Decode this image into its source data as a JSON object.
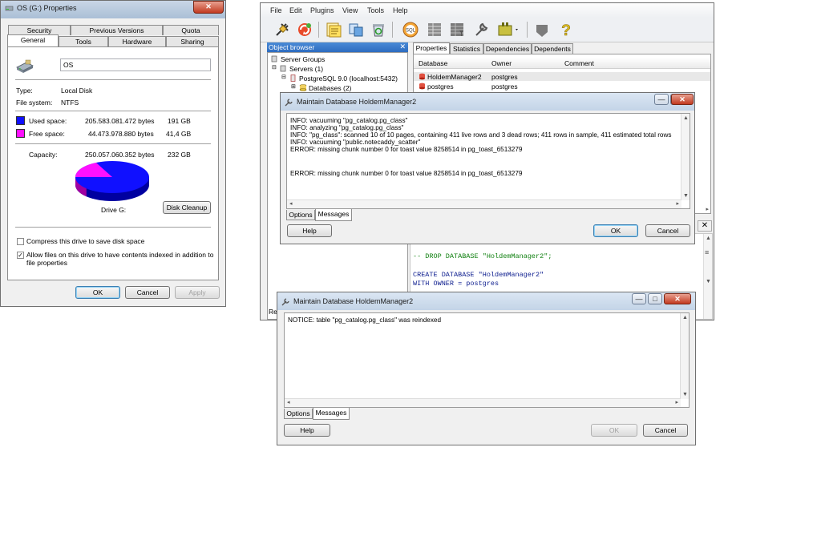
{
  "props": {
    "title": "OS (G:) Properties",
    "close_glyph": "✕",
    "tabs_row1": [
      "Security",
      "Previous Versions",
      "Quota"
    ],
    "tabs_row2": [
      "General",
      "Tools",
      "Hardware",
      "Sharing"
    ],
    "drive_name": "OS",
    "type_label": "Type:",
    "type_value": "Local Disk",
    "fs_label": "File system:",
    "fs_value": "NTFS",
    "used_label": "Used space:",
    "used_bytes": "205.583.081.472 bytes",
    "used_gb": "191 GB",
    "free_label": "Free space:",
    "free_bytes": "44.473.978.880 bytes",
    "free_gb": "41,4 GB",
    "cap_label": "Capacity:",
    "cap_bytes": "250.057.060.352 bytes",
    "cap_gb": "232 GB",
    "drive_label": "Drive G:",
    "disk_cleanup": "Disk Cleanup",
    "compress_label": "Compress this drive to save disk space",
    "compress_checked": false,
    "index_label_1": "Allow files on this drive to have contents indexed in addition to",
    "index_label_2": "file properties",
    "index_checked": true,
    "check_glyph": "✓",
    "ok": "OK",
    "cancel": "Cancel",
    "apply": "Apply",
    "used_color": "#1010ff",
    "free_color": "#ff10ff",
    "used_fraction": 0.822
  },
  "pgadmin": {
    "menu": [
      "File",
      "Edit",
      "Plugins",
      "View",
      "Tools",
      "Help"
    ],
    "object_browser_title": "Object browser",
    "close_glyph": "✕",
    "tree": [
      "Server Groups",
      "Servers (1)",
      "PostgreSQL 9.0 (localhost:5432)",
      "Databases (2)"
    ],
    "tabs": [
      "Properties",
      "Statistics",
      "Dependencies",
      "Dependents"
    ],
    "columns": [
      "Database",
      "Owner",
      "Comment"
    ],
    "rows": [
      {
        "database": "HoldemManager2",
        "owner": "postgres"
      },
      {
        "database": "postgres",
        "owner": "postgres"
      }
    ],
    "sql_lines": [
      "-- DROP DATABASE \"HoldemManager2\";",
      "CREATE DATABASE \"HoldemManager2\"",
      "  WITH OWNER = postgres"
    ],
    "status_fragment": "Re",
    "sql_glyph": "SQL",
    "help_glyph": "?",
    "scroll_up_glyph": "▲",
    "scroll_down_glyph": "▼",
    "scroll_right_glyph": "▸",
    "scroll_grip_glyph": "≡"
  },
  "maint1": {
    "title": "Maintain Database HoldemManager2",
    "min_glyph": "—",
    "max_glyph": "□",
    "close_glyph": "✕",
    "lines": [
      "INFO:  vacuuming \"pg_catalog.pg_class\"",
      "INFO:  analyzing \"pg_catalog.pg_class\"",
      "INFO:  \"pg_class\": scanned 10 of 10 pages, containing 411 live rows and 3 dead rows; 411 rows in sample, 411 estimated total rows",
      "INFO:  vacuuming \"public.notecaddy_scatter\"",
      "ERROR:  missing chunk number 0 for toast value 8258514 in pg_toast_6513279",
      "",
      "",
      "ERROR:  missing chunk number 0 for toast value 8258514 in pg_toast_6513279"
    ],
    "tabs": [
      "Options",
      "Messages"
    ],
    "help": "Help",
    "ok": "OK",
    "cancel": "Cancel",
    "scroll_up_glyph": "▲",
    "scroll_down_glyph": "▼",
    "scroll_left_glyph": "◂",
    "scroll_right_glyph": "▸"
  },
  "maint2": {
    "title": "Maintain Database HoldemManager2",
    "min_glyph": "—",
    "max_glyph": "□",
    "close_glyph": "✕",
    "lines": [
      "NOTICE:  table \"pg_catalog.pg_class\" was reindexed"
    ],
    "tabs": [
      "Options",
      "Messages"
    ],
    "help": "Help",
    "ok": "OK",
    "cancel": "Cancel",
    "scroll_up_glyph": "▲",
    "scroll_down_glyph": "▼",
    "scroll_left_glyph": "◂",
    "scroll_right_glyph": "▸"
  }
}
